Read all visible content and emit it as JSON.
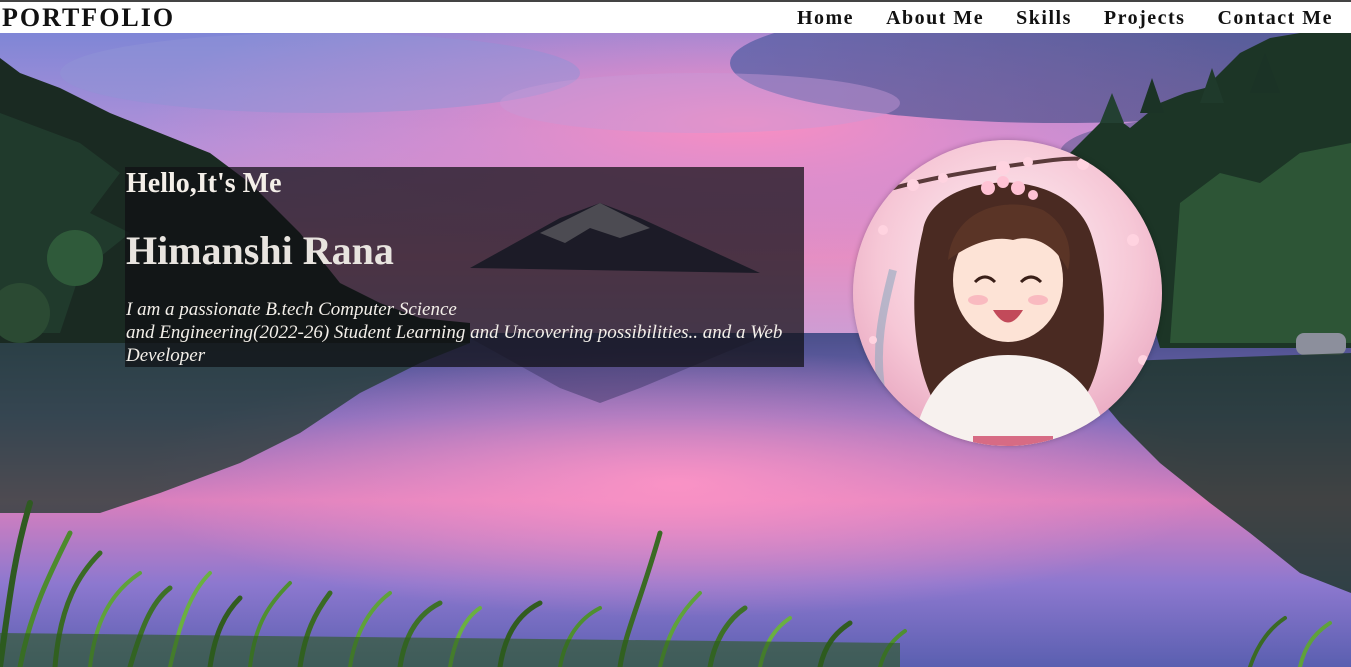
{
  "header": {
    "logo": "PORTFOLIO",
    "nav": [
      {
        "label": "Home"
      },
      {
        "label": "About Me"
      },
      {
        "label": "Skills"
      },
      {
        "label": "Projects"
      },
      {
        "label": "Contact Me"
      }
    ]
  },
  "hero": {
    "greeting": "Hello,It's Me",
    "name": "Himanshi Rana",
    "bio_line1": "I am a passionate B.tech Computer Science",
    "bio_line2": "and Engineering(2022-26) Student Learning and Uncovering possibilities.. and a Web Developer"
  },
  "colors": {
    "nav_text": "#111111",
    "header_bg": "#ffffff",
    "card_bg": "rgba(15,15,20,0.72)",
    "card_text": "#f1ede8",
    "sky_pink": "#e88cbc",
    "lake_purple": "#6a5fb0"
  }
}
